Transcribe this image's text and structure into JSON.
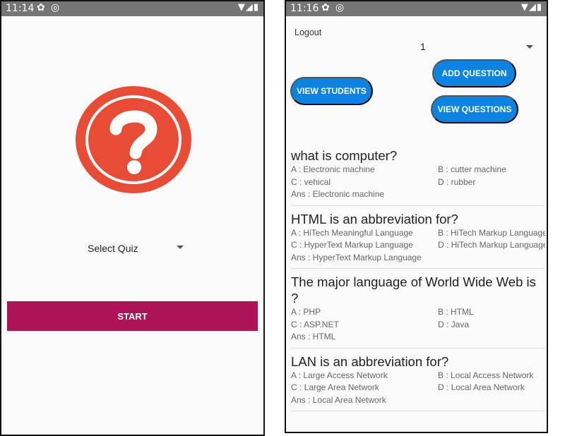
{
  "left_screen": {
    "status_bar": {
      "time": "11:14",
      "icons": [
        "gear-icon",
        "vpn-icon",
        "wifi-icon",
        "signal-icon",
        "battery-icon"
      ]
    },
    "logo_icon": "question-mark-icon",
    "logo_color": "#e84c35",
    "quiz_select": {
      "selected": "Select Quiz"
    },
    "start_button": {
      "label": "START",
      "color": "#ad1457"
    }
  },
  "right_screen": {
    "status_bar": {
      "time": "11:16",
      "icons": [
        "gear-icon",
        "vpn-icon",
        "wifi-icon",
        "signal-icon",
        "battery-icon"
      ]
    },
    "logout_label": "Logout",
    "quiz_number_select": {
      "selected": "1"
    },
    "buttons": {
      "view_students": "VIEW STUDENTS",
      "add_question": "ADD QUESTION",
      "view_questions": "VIEW QUESTIONS",
      "color": "#0a84e0"
    },
    "questions": [
      {
        "question": "what is computer?",
        "a": "A : Electronic machine",
        "b": "B : cutter machine",
        "c": "C : vehical",
        "d": "D : rubber",
        "ans": "Ans : Electronic machine"
      },
      {
        "question": "HTML is an abbreviation for?",
        "a": "A : HiTech Meaningful Language",
        "b": "B : HiTech Markup Language",
        "c": "C : HyperText Markup Language",
        "d": "D : HiTech Markup Language",
        "ans": "Ans : HyperText Markup Language"
      },
      {
        "question": "The major language of World Wide Web is ?",
        "a": "A : PHP",
        "b": "B : HTML",
        "c": "C : ASP.NET",
        "d": "D : Java",
        "ans": "Ans : HTML"
      },
      {
        "question": "LAN is an abbreviation for?",
        "a": "A : Large Access Network",
        "b": "B : Local Access Network",
        "c": "C : Large Area Network",
        "d": "D : Local Area Network",
        "ans": "Ans : Local Area Network"
      }
    ]
  }
}
